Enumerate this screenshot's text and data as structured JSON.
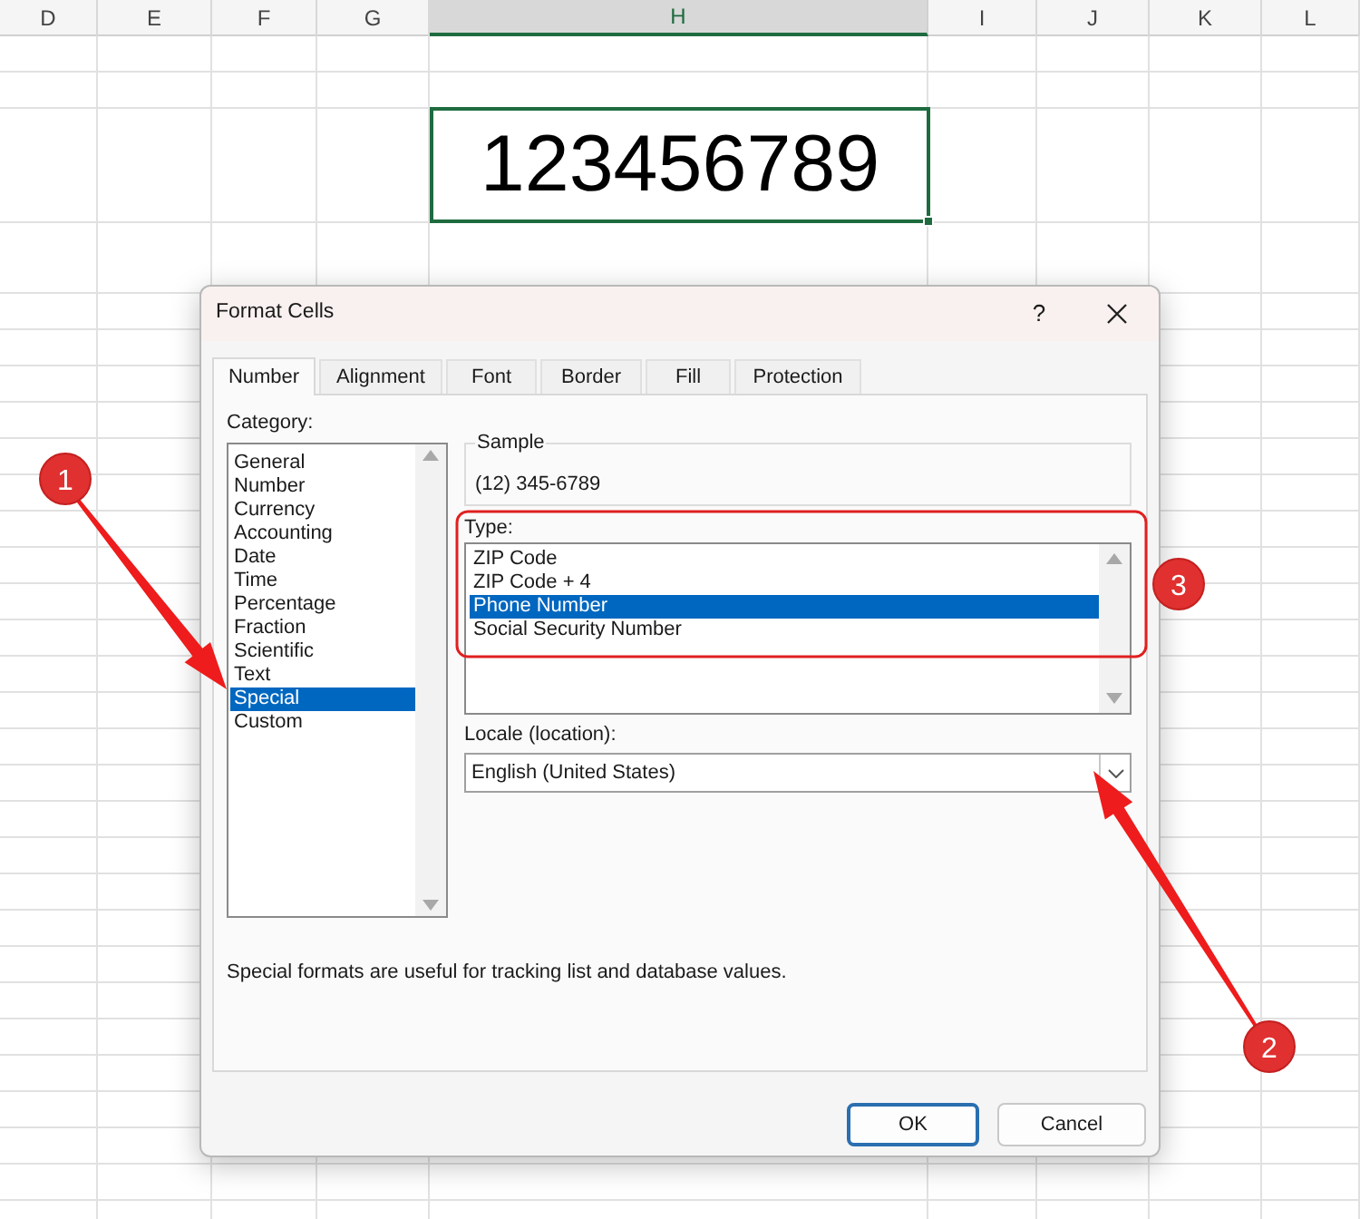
{
  "sheet": {
    "columns": [
      {
        "label": "D",
        "selected": false
      },
      {
        "label": "E",
        "selected": false
      },
      {
        "label": "F",
        "selected": false
      },
      {
        "label": "G",
        "selected": false
      },
      {
        "label": "H",
        "selected": true
      },
      {
        "label": "I",
        "selected": false
      },
      {
        "label": "J",
        "selected": false
      },
      {
        "label": "K",
        "selected": false
      },
      {
        "label": "L",
        "selected": false
      }
    ],
    "cell_value": "123456789"
  },
  "dialog": {
    "title": "Format Cells",
    "help": "?",
    "tabs": [
      {
        "label": "Number",
        "selected": true
      },
      {
        "label": "Alignment",
        "selected": false
      },
      {
        "label": "Font",
        "selected": false
      },
      {
        "label": "Border",
        "selected": false
      },
      {
        "label": "Fill",
        "selected": false
      },
      {
        "label": "Protection",
        "selected": false
      }
    ],
    "category": {
      "label": "Category:",
      "items": [
        {
          "label": "General",
          "selected": false
        },
        {
          "label": "Number",
          "selected": false
        },
        {
          "label": "Currency",
          "selected": false
        },
        {
          "label": "Accounting",
          "selected": false
        },
        {
          "label": "Date",
          "selected": false
        },
        {
          "label": "Time",
          "selected": false
        },
        {
          "label": "Percentage",
          "selected": false
        },
        {
          "label": "Fraction",
          "selected": false
        },
        {
          "label": "Scientific",
          "selected": false
        },
        {
          "label": "Text",
          "selected": false
        },
        {
          "label": "Special",
          "selected": true
        },
        {
          "label": "Custom",
          "selected": false
        }
      ]
    },
    "sample": {
      "label": "Sample",
      "value": "(12) 345-6789"
    },
    "type": {
      "label": "Type:",
      "items": [
        {
          "label": "ZIP Code",
          "selected": false
        },
        {
          "label": "ZIP Code + 4",
          "selected": false
        },
        {
          "label": "Phone Number",
          "selected": true
        },
        {
          "label": "Social Security Number",
          "selected": false
        }
      ]
    },
    "locale": {
      "label": "Locale (location):",
      "value": "English (United States)"
    },
    "description": "Special formats are useful for tracking list and database values.",
    "buttons": [
      {
        "label": "OK",
        "kind": "default"
      },
      {
        "label": "Cancel",
        "kind": "normal"
      }
    ]
  },
  "annotations": [
    {
      "number": "1"
    },
    {
      "number": "2"
    },
    {
      "number": "3"
    }
  ]
}
